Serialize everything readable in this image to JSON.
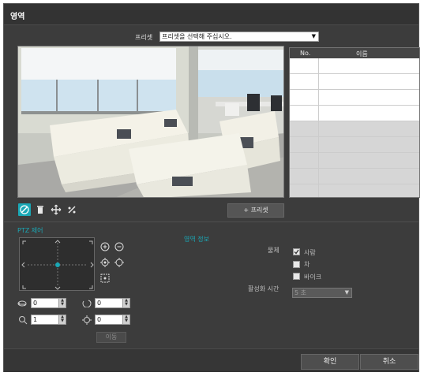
{
  "title": "영역",
  "preset": {
    "label": "프리셋",
    "selected": "프리셋을 선택해 주십시오."
  },
  "table": {
    "columns": [
      "No.",
      "이름"
    ]
  },
  "toolbar": {
    "add_preset": "+ 프리셋"
  },
  "ptz": {
    "label": "PTZ 제어",
    "pan": "0",
    "tilt": "0",
    "zoom": "1",
    "focus": "0",
    "move": "이동"
  },
  "area_info": {
    "label": "영역 정보",
    "object_label": "물체",
    "objects": [
      {
        "label": "사람",
        "checked": true
      },
      {
        "label": "차",
        "checked": false
      },
      {
        "label": "바이크",
        "checked": false
      }
    ],
    "activation_label": "활성화 시간",
    "activation_value": "5 초"
  },
  "footer": {
    "ok": "확인",
    "cancel": "취소"
  },
  "colors": {
    "accent": "#1aa7b5",
    "background": "#3c3c3c"
  }
}
